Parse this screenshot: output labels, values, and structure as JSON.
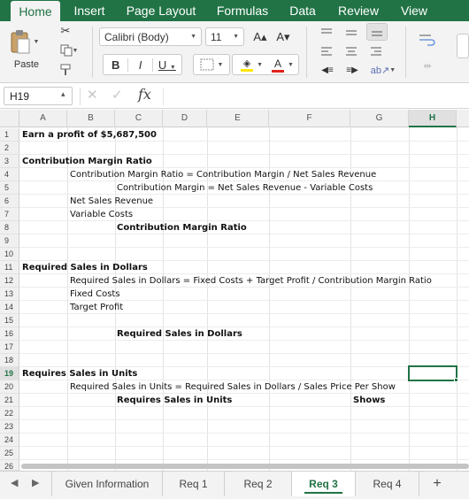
{
  "ribbon_tabs": [
    "Home",
    "Insert",
    "Page Layout",
    "Formulas",
    "Data",
    "Review",
    "View"
  ],
  "ribbon": {
    "paste_label": "Paste",
    "font_name": "Calibri (Body)",
    "font_size": "11",
    "bold": "B",
    "italic": "I",
    "underline": "U",
    "grow_font": "A▴",
    "shrink_font": "A▾",
    "font_color_letter": "A",
    "font_color": "#e0231b",
    "highlight_color": "#ffe600"
  },
  "formula_bar": {
    "name_box": "H19",
    "fx": "fx",
    "formula": ""
  },
  "columns": [
    "A",
    "B",
    "C",
    "D",
    "E",
    "F",
    "G",
    "H"
  ],
  "selected_column": "H",
  "selected_row": 19,
  "rows": [
    "1",
    "2",
    "3",
    "4",
    "5",
    "6",
    "7",
    "8",
    "9",
    "10",
    "11",
    "12",
    "13",
    "14",
    "15",
    "16",
    "17",
    "18",
    "19",
    "20",
    "21",
    "22",
    "23",
    "24",
    "25",
    "26"
  ],
  "cells": {
    "r1a": "Earn a profit of $5,687,500",
    "r3a": "Contribution Margin Ratio",
    "r4b": "Contribution Margin Ratio = Contribution Margin / Net Sales Revenue",
    "r5c": "Contribution Margin = Net Sales Revenue - Variable Costs",
    "r6b": "Net Sales Revenue",
    "r7b": "Variable Costs",
    "r8c": "Contribution Margin Ratio",
    "r11a": "Required Sales in Dollars",
    "r12b": "Required Sales in Dollars = Fixed Costs + Target Profit / Contribution Margin Ratio",
    "r13b": "Fixed Costs",
    "r14b": "Target Profit",
    "r16c": "Required Sales in Dollars",
    "r19a": "Requires Sales in Units",
    "r20b": "Required Sales in Units = Required Sales in Dollars / Sales Price Per Show",
    "r21c": "Requires Sales in Units",
    "r21g": "Shows"
  },
  "sheet_tabs": [
    "Given Information",
    "Req 1",
    "Req 2",
    "Req 3",
    "Req 4"
  ],
  "active_sheet": "Req 3",
  "add_sheet": "+"
}
